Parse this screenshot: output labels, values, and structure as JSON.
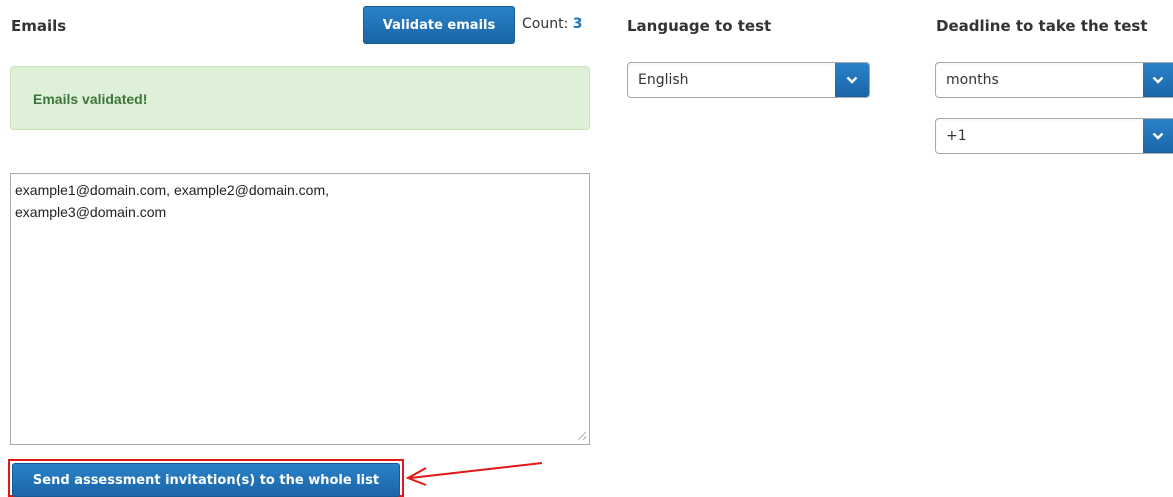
{
  "emails_section": {
    "heading": "Emails",
    "validate_button_label": "Validate emails",
    "count_label": "Count:",
    "count_value": "3",
    "alert_message": "Emails validated!",
    "textarea_value": "example1@domain.com, example2@domain.com,\nexample3@domain.com",
    "send_button_label": "Send assessment invitation(s) to the whole list"
  },
  "language_section": {
    "heading": "Language to test",
    "selected": "English"
  },
  "deadline_section": {
    "heading": "Deadline to take the test",
    "unit_selected": "months",
    "amount_selected": "+1"
  },
  "icons": {
    "select_arrow": "chevron-down-icon",
    "annotation_arrow": "arrow-left-icon"
  },
  "colors": {
    "primary": "#1f73b7",
    "success_bg": "#dff0d8",
    "success_text": "#3c763d",
    "annotation_red": "#e01818"
  }
}
